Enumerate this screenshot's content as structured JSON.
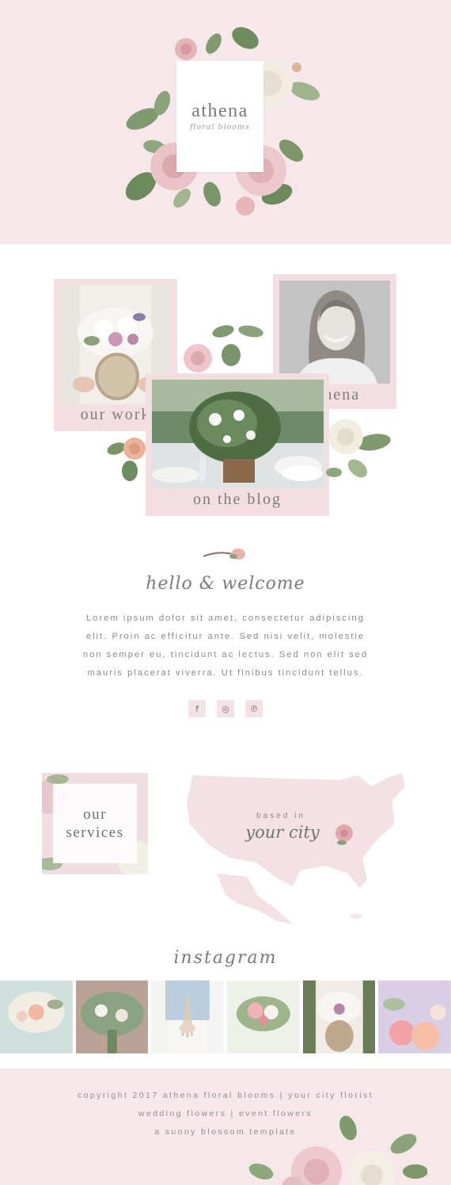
{
  "brand": {
    "title": "athena",
    "subtitle": "floral blooms"
  },
  "collage": {
    "our_work": "our work",
    "about": "athena",
    "blog": "on the blog"
  },
  "welcome": {
    "heading": "hello & welcome",
    "body": "Lorem ipsum dolor sit amet, consectetur adipiscing elit. Proin ac efficitur ante. Sed nisi velit, molestie non semper eu, tincidunt ac lectus. Sed non elit sed mauris placerat viverra. Ut finibus tincidunt tellus."
  },
  "social": [
    {
      "name": "facebook-icon",
      "glyph": "f"
    },
    {
      "name": "instagram-icon",
      "glyph": "◎"
    },
    {
      "name": "pinterest-icon",
      "glyph": "℗"
    }
  ],
  "services": {
    "line1": "our",
    "line2": "services"
  },
  "location": {
    "based_in": "based in",
    "city": "your city"
  },
  "instagram": {
    "title": "instagram"
  },
  "footer": {
    "line1": "copyright 2017 athena floral blooms | your city florist",
    "line2": "wedding flowers | event flowers",
    "line3": "a sunny blossom template"
  },
  "colors": {
    "blush": "#f6e8ea",
    "tile": "#f3dfe2",
    "leaf": "#6e8a5e",
    "rose": "#e8b9bf",
    "text": "#7a7a7a"
  }
}
